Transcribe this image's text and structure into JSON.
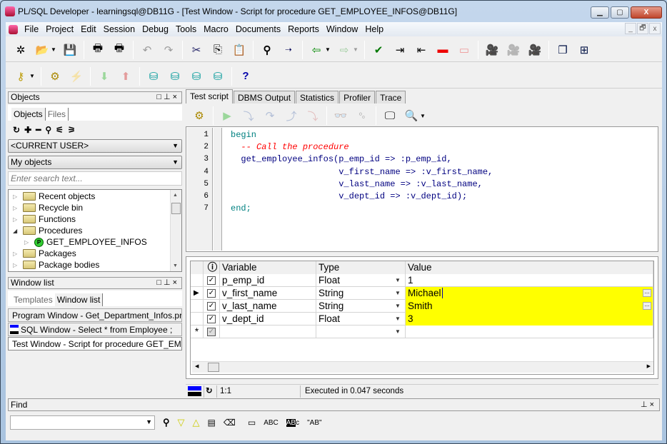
{
  "window": {
    "title": "PL/SQL Developer - learningsql@DB11G - [Test Window - Script for procedure GET_EMPLOYEE_INFOS@DB11G]",
    "caption_buttons": [
      "minimize",
      "maximize",
      "close"
    ]
  },
  "menu": {
    "items": [
      "File",
      "Project",
      "Edit",
      "Session",
      "Debug",
      "Tools",
      "Macro",
      "Documents",
      "Reports",
      "Window",
      "Help"
    ],
    "mdi_buttons": [
      "_",
      "🗗",
      "x"
    ]
  },
  "toolbar1": {
    "icons": [
      "new-icon",
      "open-icon",
      "save-icon",
      "print-icon",
      "print-preview-icon",
      "undo-icon",
      "redo-icon",
      "cut-icon",
      "copy-icon",
      "paste-icon",
      "find-icon",
      "find-next-icon",
      "load-icon",
      "save-as-icon",
      "compile-icon",
      "indent-icon",
      "unindent-icon",
      "comment-icon",
      "uncomment-icon",
      "record-macro-icon",
      "play-macro-icon",
      "macro-library-icon",
      "cascade-windows-icon",
      "tile-windows-icon"
    ]
  },
  "toolbar2": {
    "icons": [
      "log-on-icon",
      "compile-invalid-objects-icon",
      "break-icon",
      "import-icon",
      "export-icon",
      "explain-plan-icon",
      "sql-icon",
      "find-db-objects-icon",
      "rollback-icon",
      "help-icon"
    ],
    "help_glyph": "?"
  },
  "objects_panel": {
    "title": "Objects",
    "tabs": [
      "Objects",
      "Files"
    ],
    "user_select": "<CURRENT USER>",
    "filter_select": "My objects",
    "search_placeholder": "Enter search text...",
    "tree": [
      {
        "label": "Recent objects",
        "expanded": false,
        "level": 0
      },
      {
        "label": "Recycle bin",
        "expanded": false,
        "level": 0
      },
      {
        "label": "Functions",
        "expanded": false,
        "level": 0
      },
      {
        "label": "Procedures",
        "expanded": true,
        "level": 0
      },
      {
        "label": "GET_EMPLOYEE_INFOS",
        "expanded": false,
        "level": 1,
        "badge": "P"
      },
      {
        "label": "Packages",
        "expanded": false,
        "level": 0
      },
      {
        "label": "Package bodies",
        "expanded": false,
        "level": 0
      }
    ]
  },
  "window_list_panel": {
    "title": "Window list",
    "tabs": [
      "Templates",
      "Window list"
    ],
    "items": [
      {
        "label": "Program Window - Get_Department_Infos.prc",
        "color": "#ffff00",
        "active": false
      },
      {
        "label": "SQL Window - Select * from Employee ;",
        "color": "#0000ff",
        "active": false
      },
      {
        "label": "Test Window - Script for procedure GET_EMPLOYEE_INFOS",
        "color": "#0000ff",
        "active": true
      }
    ]
  },
  "test_window": {
    "tabs": [
      "Test script",
      "DBMS Output",
      "Statistics",
      "Profiler",
      "Trace"
    ],
    "active_tab": "Test script",
    "code": [
      {
        "n": "1",
        "text": "begin",
        "kind": "kw"
      },
      {
        "n": "2",
        "text": "  -- Call the procedure",
        "kind": "cm"
      },
      {
        "n": "3",
        "text": "  get_employee_infos(p_emp_id => :p_emp_id,",
        "kind": "id"
      },
      {
        "n": "4",
        "text": "                     v_first_name => :v_first_name,",
        "kind": "id"
      },
      {
        "n": "5",
        "text": "                     v_last_name => :v_last_name,",
        "kind": "id"
      },
      {
        "n": "6",
        "text": "                     v_dept_id => :v_dept_id);",
        "kind": "id"
      },
      {
        "n": "7",
        "text": "end;",
        "kind": "kw"
      }
    ],
    "variables": {
      "columns": [
        "",
        "Variable",
        "Type",
        "Value"
      ],
      "rows": [
        {
          "checked": true,
          "variable": "p_emp_id",
          "type": "Float",
          "value": "1",
          "highlight": false,
          "current": false,
          "ellipsis": false
        },
        {
          "checked": true,
          "variable": "v_first_name",
          "type": "String",
          "value": "Michael",
          "highlight": true,
          "current": true,
          "ellipsis": true
        },
        {
          "checked": true,
          "variable": "v_last_name",
          "type": "String",
          "value": "Smith",
          "highlight": true,
          "current": false,
          "ellipsis": true
        },
        {
          "checked": true,
          "variable": "v_dept_id",
          "type": "Float",
          "value": "3",
          "highlight": true,
          "current": false,
          "ellipsis": false
        }
      ],
      "new_row_marker": "*"
    },
    "status": {
      "position": "1:1",
      "message": "Executed in 0.047 seconds"
    }
  },
  "find_panel": {
    "title": "Find",
    "input_value": "",
    "tool_labels": {
      "abc": "ABC",
      "abc_whole": "AB",
      "quoted": "\"AB\""
    }
  },
  "colors": {
    "highlight": "#ffff00",
    "keyword": "#008080",
    "comment": "#ff0000",
    "identifier": "#000080"
  }
}
